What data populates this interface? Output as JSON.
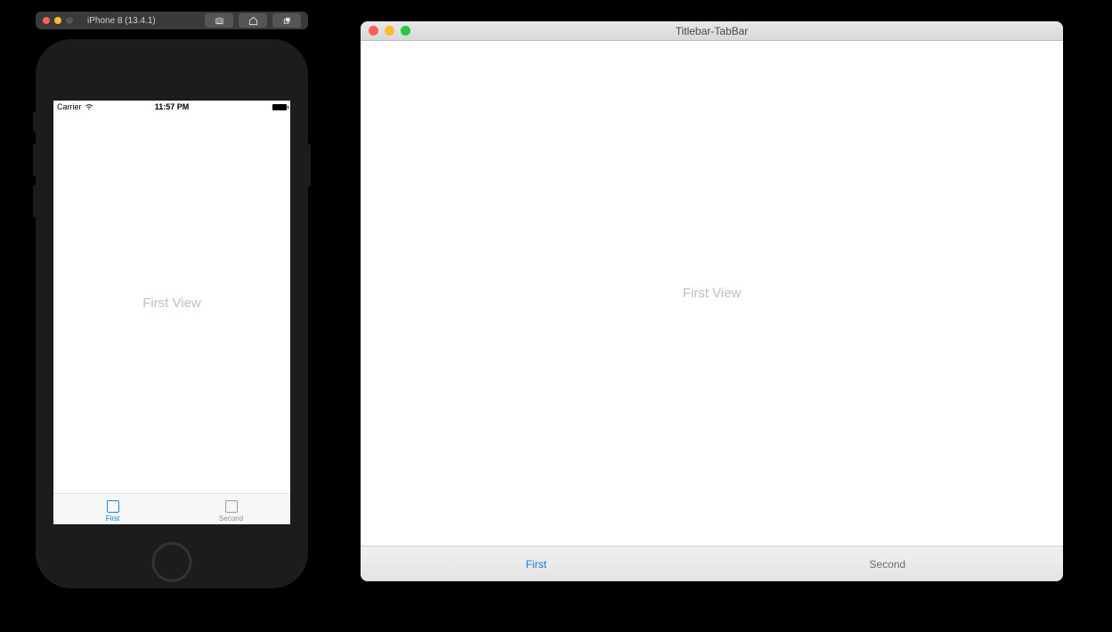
{
  "simulator": {
    "device_label": "iPhone 8 (13.4.1)",
    "buttons": {
      "screenshot": "screenshot-icon",
      "home": "home-icon",
      "rotate": "rotate-icon"
    }
  },
  "ios": {
    "statusbar": {
      "carrier": "Carrier",
      "time": "11:57 PM"
    },
    "content_label": "First View",
    "tabs": [
      {
        "label": "First",
        "active": true
      },
      {
        "label": "Second",
        "active": false
      }
    ]
  },
  "mac": {
    "window_title": "Titlebar-TabBar",
    "content_label": "First View",
    "tabs": [
      {
        "label": "First",
        "active": true
      },
      {
        "label": "Second",
        "active": false
      }
    ]
  }
}
